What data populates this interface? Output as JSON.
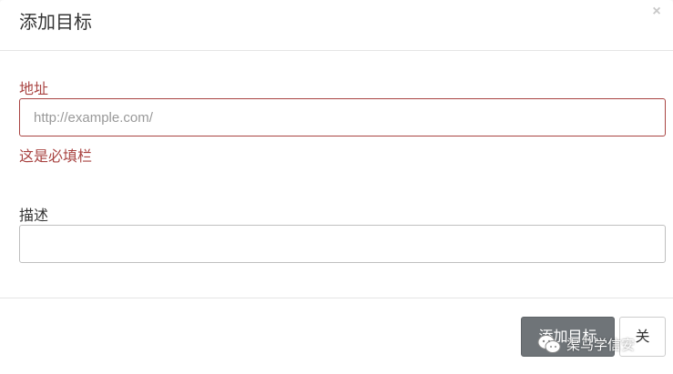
{
  "modal": {
    "title": "添加目标",
    "close_icon": "close-icon"
  },
  "form": {
    "address": {
      "label": "地址",
      "value": "",
      "placeholder": "http://example.com/",
      "error": "这是必填栏"
    },
    "description": {
      "label": "描述",
      "value": "",
      "placeholder": ""
    }
  },
  "footer": {
    "primary_label": "添加目标",
    "close_label": "关"
  },
  "watermark": {
    "text": "渠马学信安",
    "icon": "wechat-icon"
  },
  "colors": {
    "error": "#a94442",
    "primary_button": "#6f7478"
  }
}
